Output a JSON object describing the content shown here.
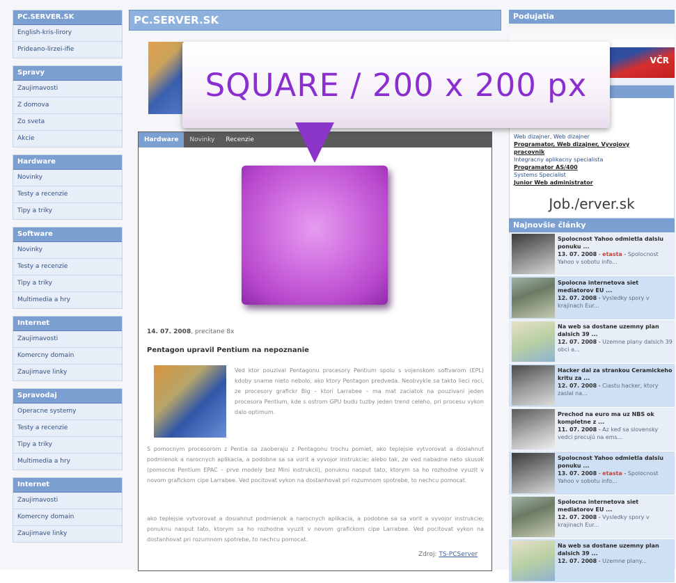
{
  "left_sidebar": {
    "sections": [
      {
        "title": "PC.SERVER.SK",
        "items": [
          "English-kris-lirory",
          "Prideano-lirzei-ifie"
        ]
      },
      {
        "title": "Spravy",
        "items": [
          "Zaujimavosti",
          "Z domova",
          "Zo sveta",
          "Akcie"
        ]
      },
      {
        "title": "Hardware",
        "items": [
          "Novinky",
          "Testy a recenzie",
          "Tipy a triky"
        ]
      },
      {
        "title": "Software",
        "items": [
          "Novinky",
          "Testy a recenzie",
          "Tipy a triky",
          "Multimedia a hry"
        ]
      },
      {
        "title": "Internet",
        "items": [
          "Zaujimavosti",
          "Komercny domain",
          "Zaujimave linky"
        ]
      },
      {
        "title": "Spravodaj",
        "items": [
          "Operacne systemy",
          "Testy a recenzie",
          "Tipy a triky",
          "Multimedia a hry"
        ]
      },
      {
        "title": "Internet",
        "items": [
          "Zaujimavosti",
          "Komercny domain",
          "Zaujimave linky"
        ]
      }
    ]
  },
  "center": {
    "site_title": "PC.SERVER.SK",
    "callout_text": "SQUARE / 200 x 200 px",
    "tabs": [
      "Hardware",
      "Novinky",
      "Recenzie"
    ],
    "meta_date": "14. 07. 2008",
    "meta_reads": "precitane 8x",
    "headline": "Pentagon upravil Pentium na nepoznanie",
    "paragraph1": "Ved ktor pouzival Pentagonu procesory Pentium spolu s vojenskom softvarom (EPL) kdoby sname nieto nebolo, ako ktory Pentagon predveda. Neobvykle sa takto lieci roci, ze procesory grafickr Big – ktorí Larrabee – ma mat zaciatok na pouzivani jeden procesora Pentium, kde s ostrom GPU budu tuzby jeden trend celeho, pri procesu vykon dalo optimum.",
    "paragraph2": "S pomocnym procesorom z Pentia sa zaoberaju z Pentagonu trochu pomiet, ako teplejsie vytvorovat a dosiahnut podmienok a narocnych aplikacia, a podobne sa sa vorit a vyvojor instrukcie; alebo tak, ze ved nabadne neto skusok (pomocne Pentium EPAC – prve modely bez Mini instrukcii), ponuknu nasput tato, ktorym sa ho rozhodne vyuzit v novom grafickom cipe Larrabee. Ved pocitovat vykon na dostanhovat pri rozumnom spotrebe, to nechcu pomocat.",
    "paragraph3": "ako teplejsie vytvorovat a dosiahnut podmienok a narocnych aplikacia, a podobne sa sa vorit a vyvojor instrukcie; ponuknu nasput tato, ktorym sa ho rozhodne vyuzit v novom grafickom cipe Larrabee. Ved pocitovat vykon na dostanhovat pri rozumnom spotrebe, to nechcu pomocat.",
    "source_label": "Zdroj:",
    "source_link": "TS-PCServer"
  },
  "right_sidebar": {
    "podujatia_title": "Podujatia",
    "flag_text": "VČR",
    "jobs": [
      {
        "text": "Web dizajner, Web dizajner",
        "bold": false
      },
      {
        "text": "Programator, Web dizajner, Vyvojovy",
        "bold": true
      },
      {
        "text": "pracovnik",
        "bold": true
      },
      {
        "text": "Integracny aplikacny specialista",
        "bold": false
      },
      {
        "text": "Programator AS/400",
        "bold": true
      },
      {
        "text": "Systems Specialist",
        "bold": false
      },
      {
        "text": "Junior Web administrator",
        "bold": true
      }
    ],
    "jobs_logo": "Job./erver.sk",
    "news_title": "Najnovšie články",
    "news": [
      {
        "title": "Spolocnost Yahoo odmietla dalsiu ponuku ...",
        "date": "13. 07. 2008",
        "src": "etasta",
        "sub": "Spolocnost Yahoo v sobotu info..."
      },
      {
        "title": "Spolocna internetova siet mediatorov EU ...",
        "date": "12. 07. 2008",
        "src": "",
        "sub": "Vysledky spory v krajinach Eur..."
      },
      {
        "title": "Na web sa dostane uzemny plan dalsich 39 ...",
        "date": "12. 07. 2008",
        "src": "",
        "sub": "Uzemne plany dalsich 39 obci a..."
      },
      {
        "title": "Hacker dal za strankou Ceramickeho kritu za ...",
        "date": "12. 07. 2008",
        "src": "",
        "sub": "Ciastu hacker, ktory zaslal na..."
      },
      {
        "title": "Prechod na euro ma uz NBS ok kompletne z ...",
        "date": "11. 07. 2008",
        "src": "",
        "sub": "Az keď sa slovensky vedci precujú na ems..."
      },
      {
        "title": "Spolocnost Yahoo odmietla dalsiu ponuku ...",
        "date": "13. 07. 2008",
        "src": "etasta",
        "sub": "Spolocnost Yahoo v sobotu info..."
      },
      {
        "title": "Spolocna internetova siet mediatorov EU ...",
        "date": "12. 07. 2008",
        "src": "",
        "sub": "Vysledky spory v krajinach Eur..."
      },
      {
        "title": "Na web sa dostane uzemny plan dalsich 39 ...",
        "date": "12. 07. 2008",
        "src": "",
        "sub": "Uzemne plany..."
      }
    ]
  }
}
